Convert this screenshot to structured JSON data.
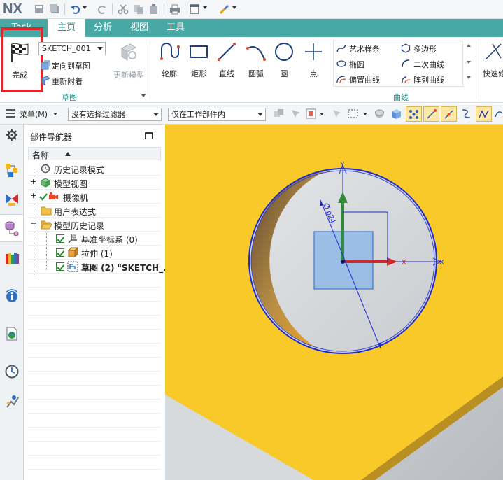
{
  "app": {
    "logo": "NX"
  },
  "tabs": [
    {
      "label": "Task"
    },
    {
      "label": "主页"
    },
    {
      "label": "分析"
    },
    {
      "label": "视图"
    },
    {
      "label": "工具"
    }
  ],
  "ribbon": {
    "finish_label": "完成",
    "sketch_name": "SKETCH_001",
    "orient_label": "定向到草图",
    "reattach_label": "重新附着",
    "update_model_label": "更新模型",
    "sketch_group_label": "草图",
    "curve_tools": [
      {
        "label": "轮廓",
        "icon": "profile-icon"
      },
      {
        "label": "矩形",
        "icon": "rectangle-icon"
      },
      {
        "label": "直线",
        "icon": "line-icon"
      },
      {
        "label": "圆弧",
        "icon": "arc-icon"
      },
      {
        "label": "圆",
        "icon": "circle-icon"
      },
      {
        "label": "点",
        "icon": "point-icon"
      }
    ],
    "curve_small": [
      "艺术样条",
      "多边形",
      "椭圆",
      "二次曲线",
      "偏置曲线",
      "阵列曲线"
    ],
    "curve_group_label": "曲线",
    "quick_label": "快速修"
  },
  "selection_bar": {
    "menu_label": "菜单(M)",
    "filter_value": "没有选择过滤器",
    "scope_value": "仅在工作部件内"
  },
  "navigator": {
    "title": "部件导航器",
    "column_header": "名称",
    "items": [
      {
        "label": "历史记录模式"
      },
      {
        "label": "模型视图"
      },
      {
        "label": "摄像机"
      },
      {
        "label": "用户表达式"
      },
      {
        "label": "模型历史记录"
      },
      {
        "label": "基准坐标系 (0)"
      },
      {
        "label": "拉伸 (1)"
      },
      {
        "label": "草图 (2) \"SKETCH_..."
      }
    ]
  },
  "viewport": {
    "dimension_text": "Ø p24.",
    "axis_x": "X",
    "axis_y": "Y",
    "colors": {
      "plate": "#f9c92a",
      "circle": "#1c2bd1",
      "hole_wall": "#8a6430",
      "accent": "#48a8a4",
      "highlight": "#e0242b"
    }
  }
}
